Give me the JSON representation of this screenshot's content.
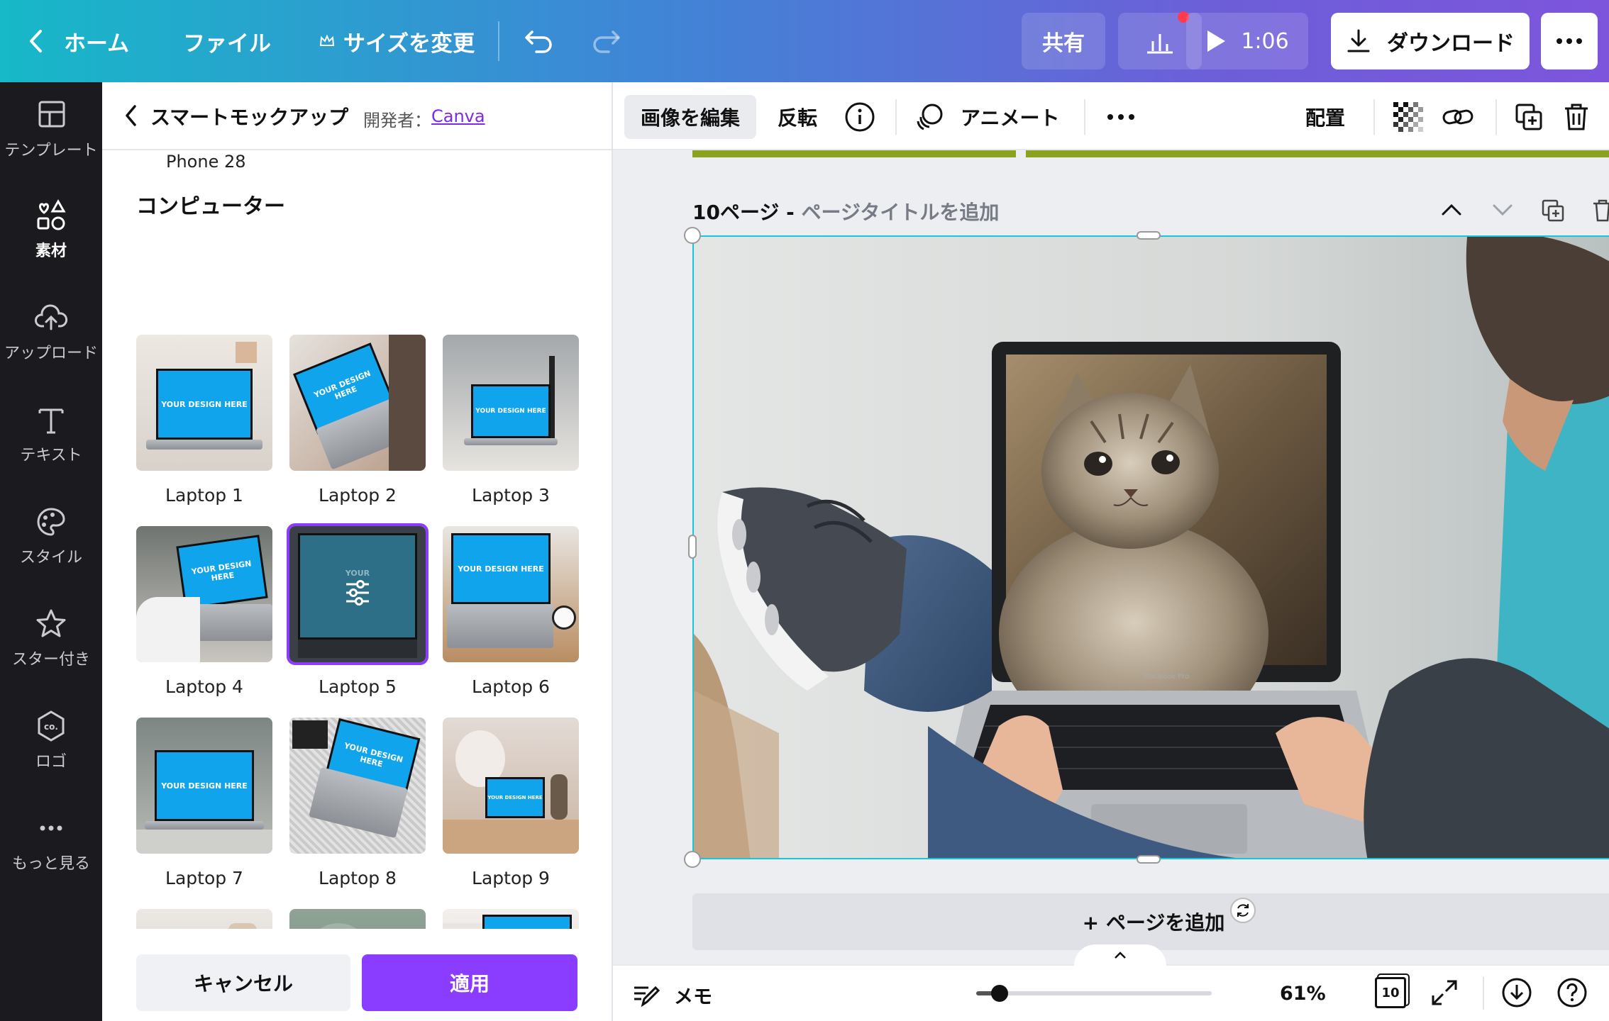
{
  "topbar": {
    "home_label": "ホーム",
    "file_label": "ファイル",
    "resize_label": "サイズを変更",
    "share_label": "共有",
    "present_time": "1:06",
    "download_label": "ダウンロード"
  },
  "rail": {
    "items": [
      {
        "label": "テンプレート",
        "icon": "template-icon"
      },
      {
        "label": "素材",
        "icon": "elements-icon"
      },
      {
        "label": "アップロード",
        "icon": "upload-icon"
      },
      {
        "label": "テキスト",
        "icon": "text-icon"
      },
      {
        "label": "スタイル",
        "icon": "palette-icon"
      },
      {
        "label": "スター付き",
        "icon": "star-icon"
      },
      {
        "label": "ロゴ",
        "icon": "logo-icon"
      },
      {
        "label": "もっと見る",
        "icon": "more-icon"
      }
    ]
  },
  "panel": {
    "title": "スマートモックアップ",
    "developer_prefix": "開発者：",
    "developer_link": "Canva",
    "phone_label": "Phone 28",
    "section_title": "コンピューター",
    "screen_text": "YOUR DESIGN HERE",
    "selected_overlay": "YOUR",
    "mockups": [
      "Laptop 1",
      "Laptop 2",
      "Laptop 3",
      "Laptop 4",
      "Laptop 5",
      "Laptop 6",
      "Laptop 7",
      "Laptop 8",
      "Laptop 9"
    ],
    "cancel_label": "キャンセル",
    "apply_label": "適用"
  },
  "toolbar": {
    "edit_image": "画像を編集",
    "flip": "反転",
    "animate": "アニメート",
    "arrange": "配置"
  },
  "canvas": {
    "page_number": "10ページ - ",
    "page_title_placeholder": "ページタイトルを追加",
    "laptop_brand": "MacBook Pro",
    "add_page": "+ ページを追加"
  },
  "bottombar": {
    "notes_label": "メモ",
    "zoom": "61%",
    "zoom_level_fraction": 0.1,
    "page_count": "10"
  },
  "colors": {
    "accent": "#8b3dff",
    "selection": "#19c6d8",
    "rail_bg": "#1b1b1f",
    "mockup_screen": "#10a4ec"
  }
}
